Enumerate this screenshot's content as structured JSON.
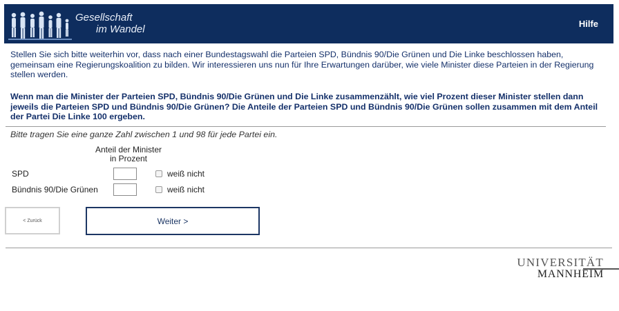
{
  "header": {
    "logo_line1": "Gesellschaft",
    "logo_line2": "im Wandel",
    "help_label": "Hilfe",
    "background": "#0e2d5e"
  },
  "intro_text": "Stellen Sie sich bitte weiterhin vor, dass nach einer Bundestagswahl die Parteien SPD, Bündnis 90/Die Grünen und Die Linke beschlossen haben, gemeinsam eine Regierungskoalition zu bilden. Wir interessieren uns nun für Ihre Erwartungen darüber, wie viele Minister diese Parteien in der Regierung stellen werden.",
  "question_text": "Wenn man die Minister der Parteien SPD, Bündnis 90/Die Grünen und Die Linke zusammenzählt, wie viel Prozent dieser Minister stellen dann jeweils die Parteien SPD und Bündnis 90/Die Grünen? Die Anteile der Parteien SPD und Bündnis 90/Die Grünen sollen zusammen mit dem Anteil der Partei Die Linke 100 ergeben.",
  "instruction_text": "Bitte tragen Sie eine ganze Zahl zwischen 1 und 98 für jede Partei ein.",
  "table": {
    "column_header_line1": "Anteil der Minister",
    "column_header_line2": "in Prozent",
    "rows": [
      {
        "label": "SPD",
        "value": "",
        "dont_know_label": "weiß nicht"
      },
      {
        "label": "Bündnis 90/Die Grünen",
        "value": "",
        "dont_know_label": "weiß nicht"
      }
    ]
  },
  "nav": {
    "back_label": "< Zurück",
    "next_label": "Weiter >"
  },
  "footer": {
    "university_line1": "UNIVERSITÄT",
    "university_line2": "MANNHEIM"
  }
}
